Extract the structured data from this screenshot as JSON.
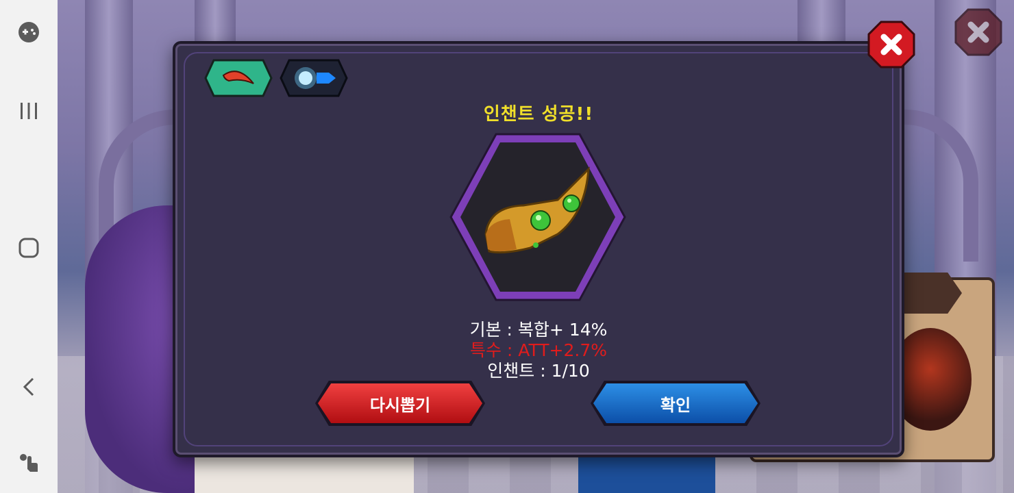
{
  "nav": {
    "icons": [
      "game-tools-icon",
      "recent-apps-icon",
      "home-icon",
      "back-icon",
      "touch-icon"
    ]
  },
  "dialog": {
    "title": "인챈트 성공!!",
    "tabs": [
      {
        "name": "item-tab",
        "icon": "red-feather-icon",
        "color": "#2fb58a"
      },
      {
        "name": "enchant-tab",
        "icon": "blue-spark-arrow-icon",
        "color": "#1e2233"
      }
    ],
    "item_icon": "golden-green-gem-bracer-icon",
    "stats": {
      "base": "기본 : 복합+ 14%",
      "special": "특수 : ATT+2.7%",
      "enchant": "인챈트 : 1/10"
    },
    "buttons": {
      "redraw": "다시뽑기",
      "confirm": "확인"
    }
  },
  "colors": {
    "title": "#f0df2a",
    "special_stat": "#e01c1c",
    "redraw_button": "#d61a1e",
    "confirm_button": "#1a6fcf",
    "close_button": "#d31a22"
  }
}
